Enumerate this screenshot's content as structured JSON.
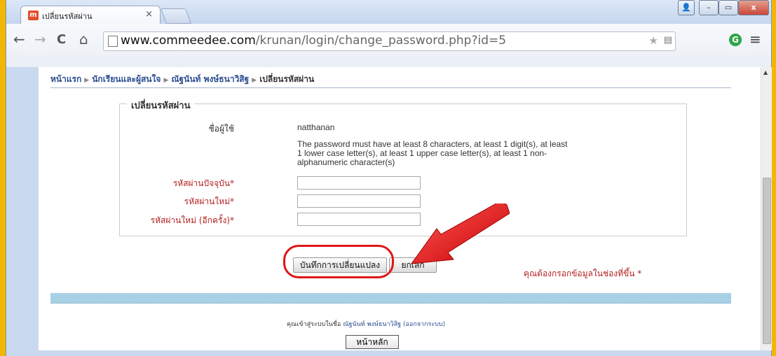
{
  "browser": {
    "tab_title": "เปลี่ยนรหัสผ่าน",
    "tab_favicon": "m",
    "tab_close": "×",
    "url_host": "www.commeedee.com",
    "url_path": "/krunan/login/change_password.php?id=5",
    "window_controls": {
      "user": "👤",
      "minimize": "–",
      "maximize": "▭",
      "close": "x"
    },
    "nav": {
      "back": "←",
      "forward": "→",
      "reload": "C",
      "home": "⌂"
    },
    "extension_icon": "G",
    "menu": "≡"
  },
  "breadcrumb": {
    "items": [
      "หน้าแรก",
      "นักเรียนและผู้สนใจ",
      "ณัฐนันท์ พงษ์ธนาวิสิฐ"
    ],
    "current": "เปลี่ยนรหัสผ่าน",
    "separator": "▶"
  },
  "form": {
    "legend": "เปลี่ยนรหัสผ่าน",
    "username_label": "ชื่อผู้ใช้",
    "username_value": "natthanan",
    "password_rule_1": "The password must have at least 8 characters, at least 1 digit(s), at least",
    "password_rule_2": "1 lower case letter(s), at least 1 upper case letter(s), at least 1 non-",
    "password_rule_3": "alphanumeric character(s)",
    "current_password_label": "รหัสผ่านปัจจุบัน",
    "new_password_label": "รหัสผ่านใหม่",
    "new_password_again_label": "รหัสผ่านใหม่ (อีกครั้ง)",
    "required_mark": "*",
    "save_button": "บันทึกการเปลี่ยนแปลง",
    "cancel_button": "ยกเลิก",
    "required_note": "คุณต้องกรอกข้อมูลในช่องที่ขึ้น *"
  },
  "footer": {
    "logged_in_prefix": "คุณเข้าสู่ระบบในชื่อ",
    "user_link": "ณัฐนันท์ พงษ์ธนาวิสิฐ",
    "logout_link": "(ออกจากระบบ)",
    "home_button": "หน้าหลัก"
  },
  "colors": {
    "required": "#b41f1f",
    "link": "#2a4d8f",
    "highlight": "#e01616",
    "divider": "#a9d1e6"
  }
}
